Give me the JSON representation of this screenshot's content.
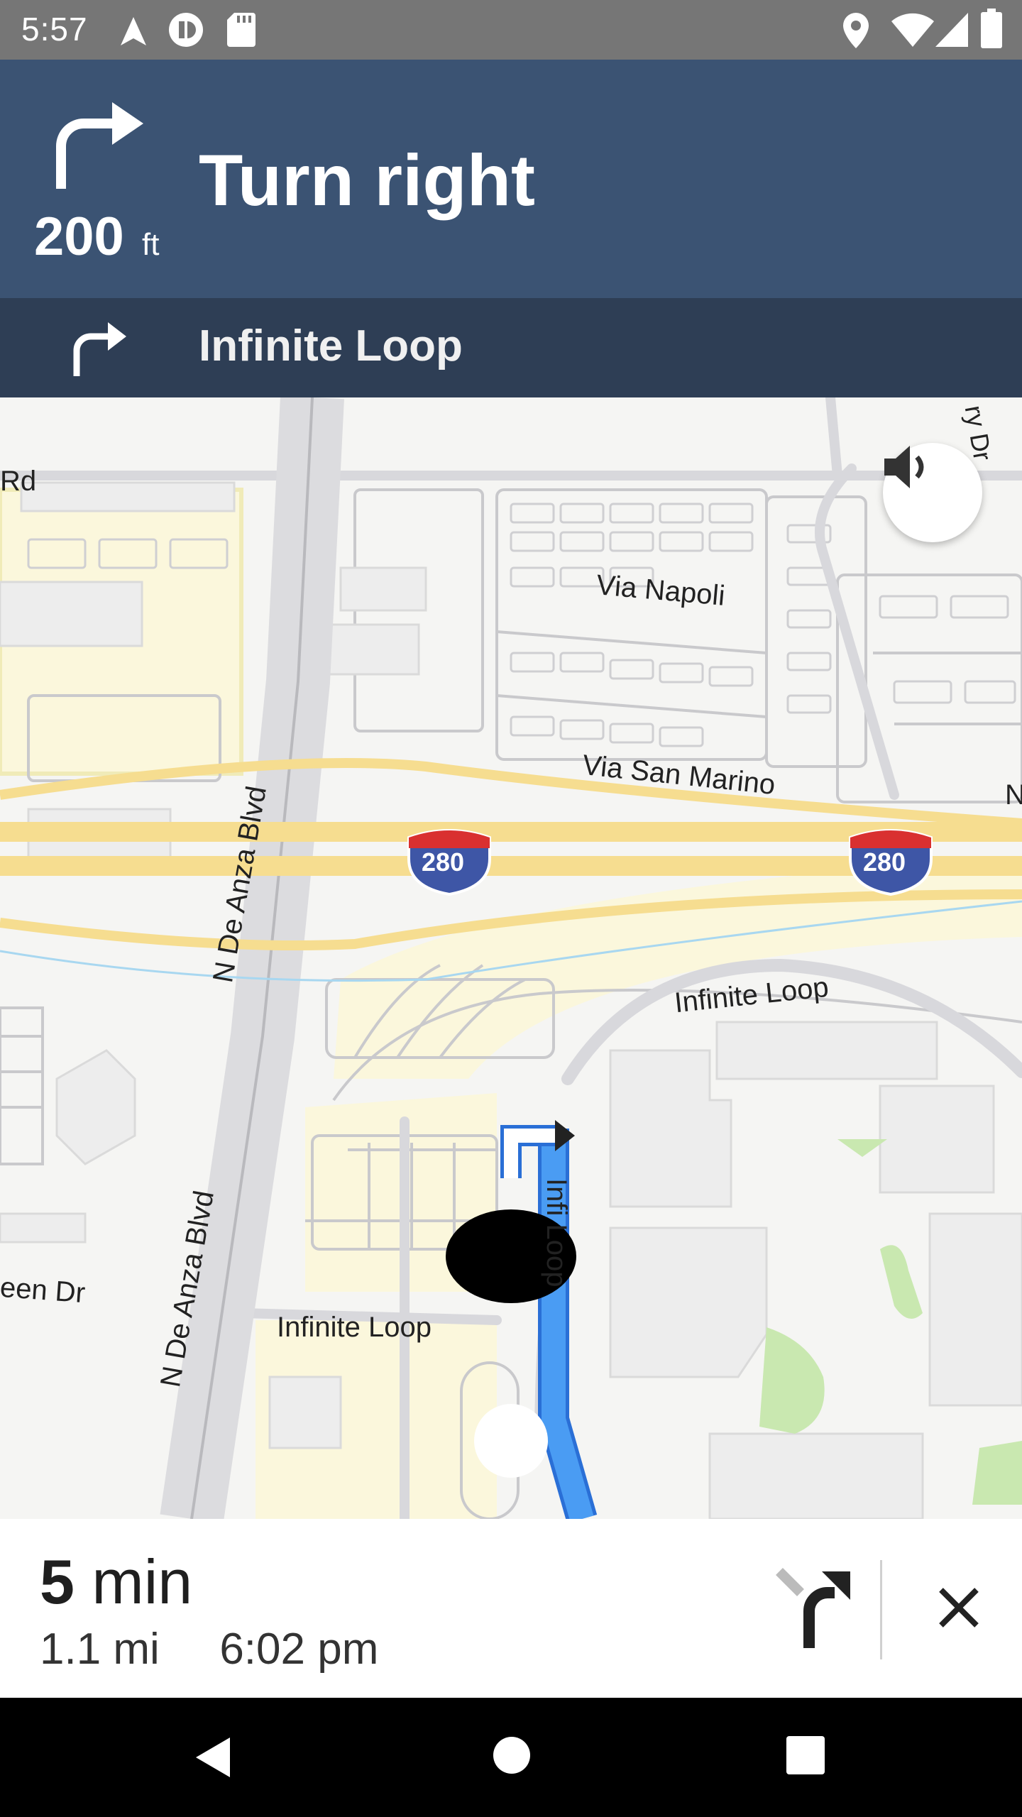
{
  "status_bar": {
    "time": "5:57",
    "icons": [
      "navigation-arrow-icon",
      "app-notification-icon",
      "sd-card-icon",
      "location-pin-icon",
      "wifi-icon",
      "cell-signal-icon",
      "battery-icon"
    ]
  },
  "nav": {
    "maneuver": "Turn right",
    "distance_value": "200",
    "distance_unit": "ft",
    "maneuver_icon": "turn-right-arrow-icon",
    "next_street": "Infinite Loop",
    "next_icon": "turn-right-arrow-icon",
    "header_color": "#3b5373",
    "subheader_color": "#2e3e55"
  },
  "map": {
    "labels": {
      "rd": "Rd",
      "corner": "ry Dr",
      "via_napoli": "Via Napoli",
      "via_san_marino": "Via San Marino",
      "right_edge_n": "N",
      "de_anza_upper": "N De Anza Blvd",
      "de_anza_lower": "N De Anza Blvd",
      "infinite_loop_arc": "Infinite Loop",
      "infinite_loop_lower": "Infinite Loop",
      "infinite_loop_route": "Infi Loop",
      "een_dr": "een Dr"
    },
    "highway_shields": [
      "280",
      "280"
    ],
    "route_color": "#4a9cf3"
  },
  "trip": {
    "minutes_value": "5",
    "minutes_unit": "min",
    "distance": "1.1 mi",
    "arrival": "6:02 pm"
  }
}
